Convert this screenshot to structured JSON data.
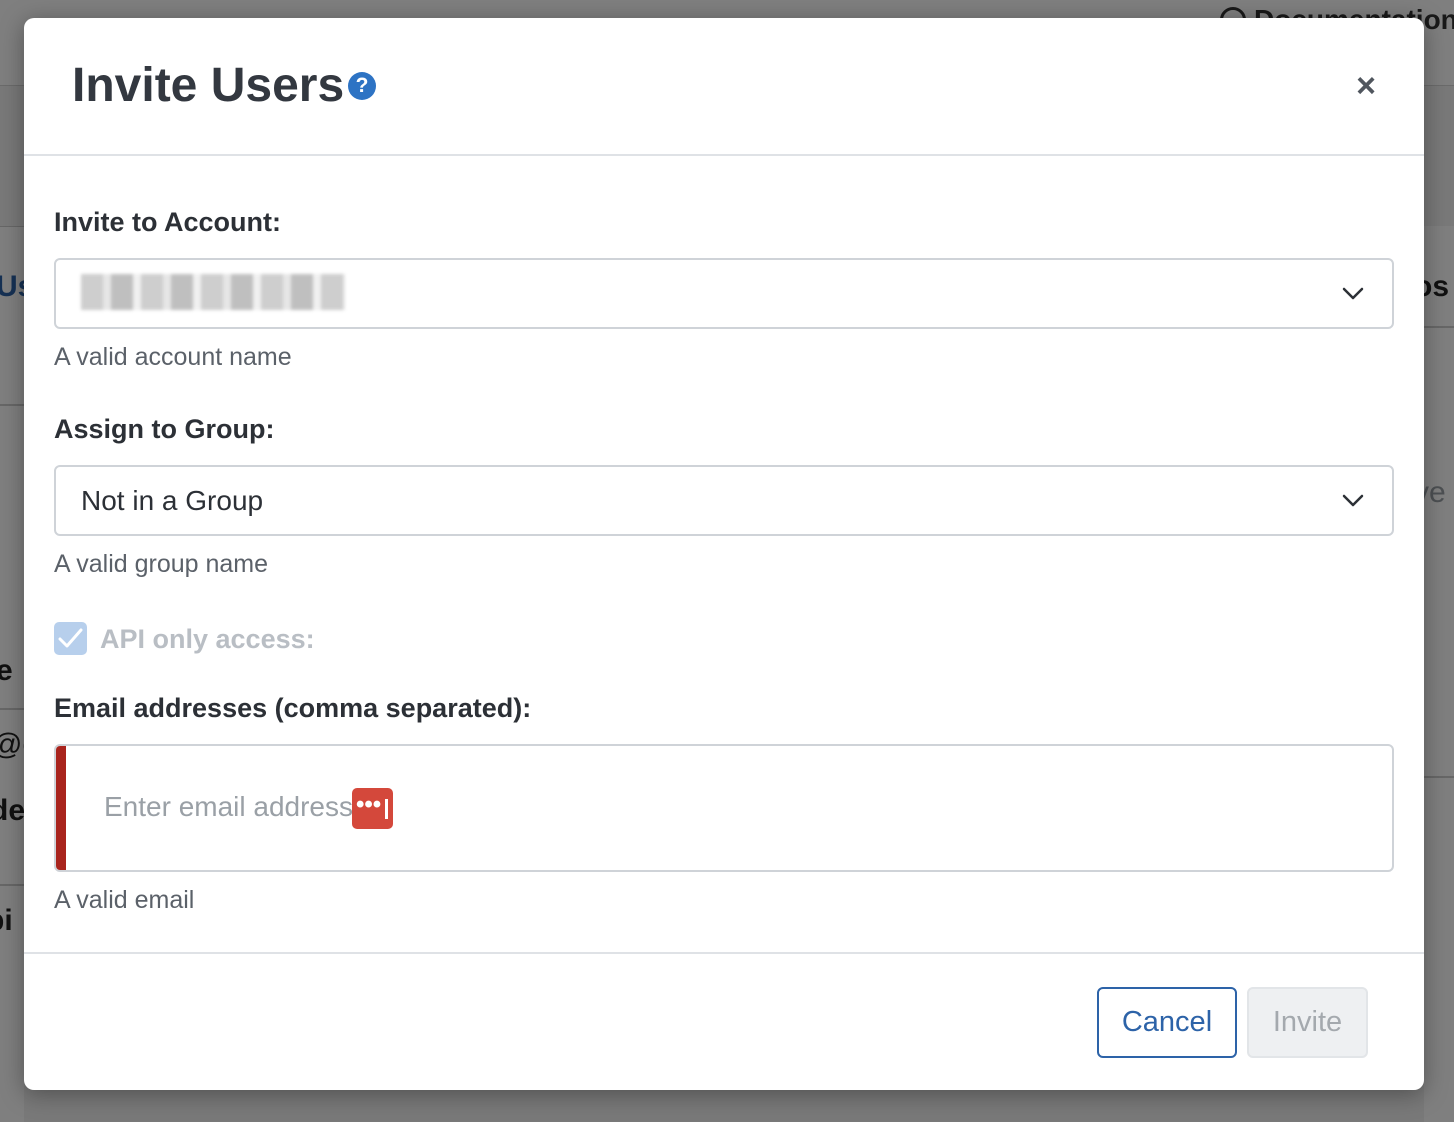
{
  "background": {
    "doc_link": "Documentation",
    "fragments": [
      "Us",
      "s",
      "e",
      "@c",
      "de",
      "bi",
      "os",
      "ve"
    ]
  },
  "modal": {
    "title": "Invite Users",
    "help_icon": "question-circle-icon",
    "close_icon": "close-icon",
    "close_glyph": "×",
    "account": {
      "label": "Invite to Account:",
      "value": "",
      "value_redacted": true,
      "help": "A valid account name"
    },
    "group": {
      "label": "Assign to Group:",
      "value": "Not in a Group",
      "help": "A valid group name"
    },
    "api_only": {
      "label": "API only access:",
      "checked": true,
      "disabled": true
    },
    "emails": {
      "label": "Email addresses (comma separated):",
      "placeholder": "Enter email address",
      "help": "A valid email",
      "error": true
    },
    "buttons": {
      "cancel": "Cancel",
      "invite": "Invite"
    }
  },
  "colors": {
    "primary": "#2d63a8",
    "help_icon": "#2d73c4",
    "error": "#a9241d",
    "password_manager_badge": "#d4483b",
    "checkbox_disabled": "#b7cfec"
  }
}
